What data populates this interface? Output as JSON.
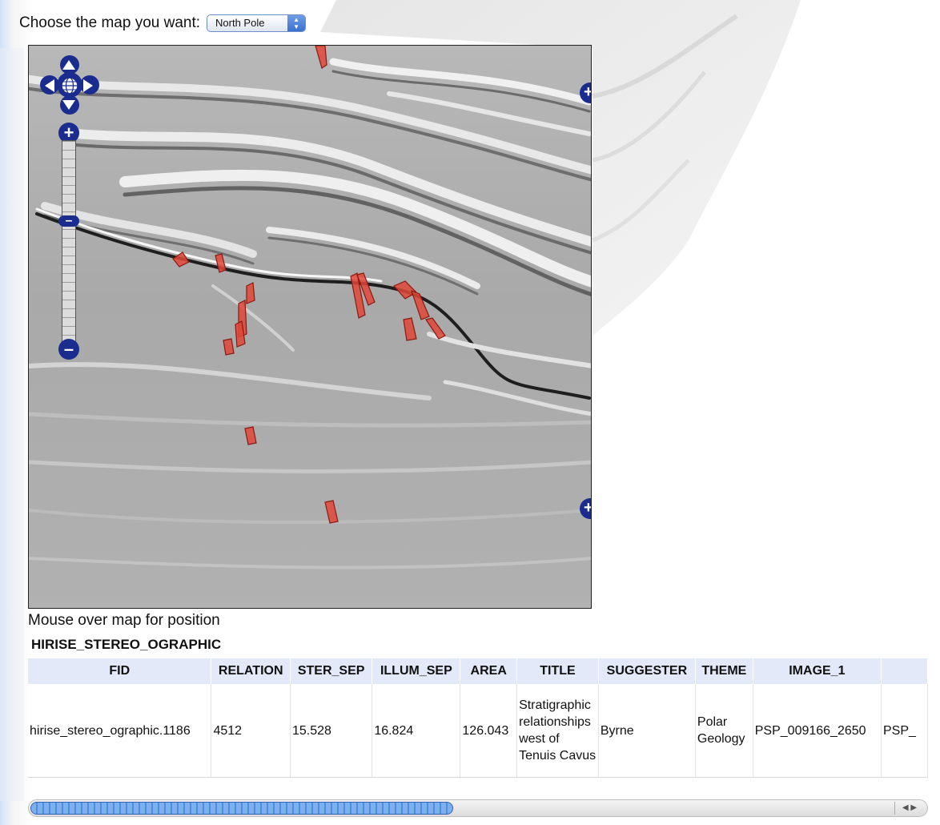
{
  "header": {
    "choose_label": "Choose the map you want:",
    "map_select_value": "North Pole"
  },
  "map": {
    "mouse_position_text": "Mouse over map for position",
    "polygon_fill": "#e0473a",
    "polygon_stroke": "#8a1a10",
    "controls_color": "#1a2d8f"
  },
  "results": {
    "layer_title": "HIRISE_STEREO_OGRAPHIC",
    "columns": [
      "FID",
      "RELATION",
      "STER_SEP",
      "ILLUM_SEP",
      "AREA",
      "TITLE",
      "SUGGESTER",
      "THEME",
      "IMAGE_1"
    ],
    "row": {
      "fid": "hirise_stereo_ographic.1186",
      "relation": "4512",
      "ster_sep": "15.528",
      "illum_sep": "16.824",
      "area": "126.043",
      "title": "Stratigraphic relationships west of Tenuis Cavus",
      "suggester": "Byrne",
      "theme": "Polar Geology",
      "image_1": "PSP_009166_2650",
      "overflow_text": "PSP_"
    }
  }
}
